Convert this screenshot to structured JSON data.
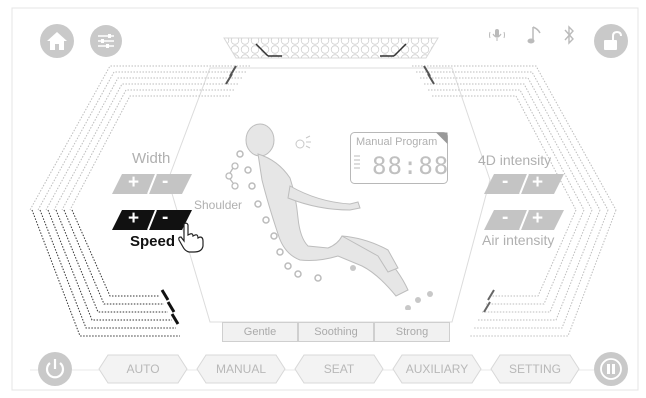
{
  "colors": {
    "button_gray": "#c9c9c9",
    "label_gray": "#b0b0b0",
    "active_black": "#111111",
    "line_gray": "#d0d0d0"
  },
  "icons": {
    "home": "home-icon",
    "settings": "sliders-icon",
    "mic": "microphone-icon",
    "music": "music-note-icon",
    "bluetooth": "bluetooth-icon",
    "lock": "unlock-icon",
    "power": "power-icon",
    "pause": "pause-icon",
    "hand": "hand-pointer-icon",
    "person": "person-in-chair-icon"
  },
  "left_panel": {
    "width_label": "Width",
    "speed_label": "Speed",
    "shoulder_label": "Shoulder",
    "plus": "+",
    "minus": "-"
  },
  "right_panel": {
    "intensity_4d_label": "4D intensity",
    "air_intensity_label": "Air intensity",
    "plus": "+",
    "minus": "-"
  },
  "center": {
    "program_title": "Manual Program",
    "timer": "88:88",
    "tabs": [
      "Gentle",
      "Soothing",
      "Strong"
    ]
  },
  "bottom_nav": {
    "items": [
      "AUTO",
      "MANUAL",
      "SEAT",
      "AUXILIARY",
      "SETTING"
    ]
  }
}
